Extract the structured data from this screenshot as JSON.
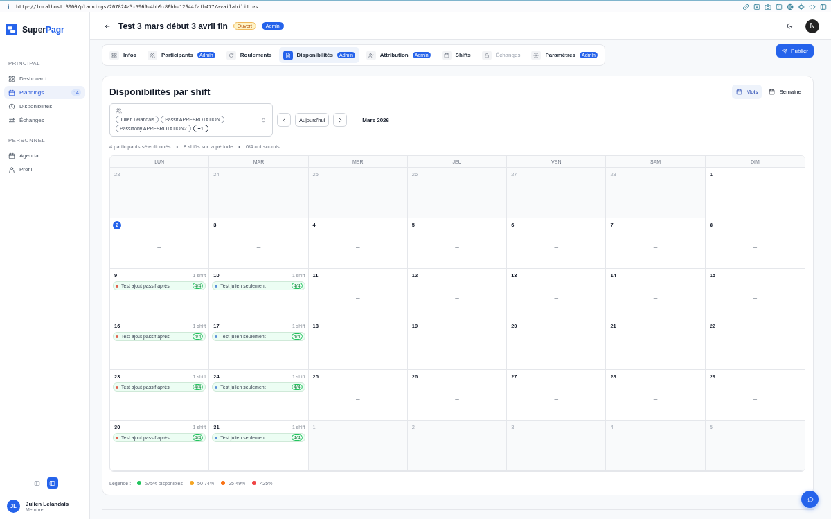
{
  "browser": {
    "url": "http://localhost:3000/plannings/207824a3-5969-4bb9-86bb-12644fafb477/availabilities"
  },
  "brand": {
    "lead": "Super",
    "accent": "Pagr"
  },
  "sidebar": {
    "sections": [
      {
        "title": "PRINCIPAL",
        "items": [
          {
            "label": "Dashboard",
            "selected": false
          },
          {
            "label": "Plannings",
            "selected": true,
            "badge": "14"
          },
          {
            "label": "Disponibilités",
            "selected": false
          },
          {
            "label": "Échanges",
            "selected": false
          }
        ]
      },
      {
        "title": "PERSONNEL",
        "items": [
          {
            "label": "Agenda",
            "selected": false
          },
          {
            "label": "Profil",
            "selected": false
          }
        ]
      }
    ],
    "layout_toggles": [
      {
        "selected": false
      },
      {
        "selected": true
      }
    ],
    "user": {
      "initials": "JL",
      "name": "Julien Lelandais",
      "role": "Membre"
    }
  },
  "header": {
    "title": "Test 3 mars début 3 avril fin",
    "status": "Ouvert",
    "role_badge": "Admin",
    "avatar": "N"
  },
  "tabs": [
    {
      "label": "Infos",
      "selected": false,
      "disabled": false
    },
    {
      "label": "Participants",
      "badge": "Admin",
      "selected": false,
      "disabled": false
    },
    {
      "label": "Roulements",
      "selected": false,
      "disabled": false
    },
    {
      "label": "Disponibilités",
      "badge": "Admin",
      "selected": true,
      "disabled": false
    },
    {
      "label": "Attribution",
      "badge": "Admin",
      "selected": false,
      "disabled": false
    },
    {
      "label": "Shifts",
      "selected": false,
      "disabled": false
    },
    {
      "label": "Échanges",
      "selected": false,
      "disabled": true
    },
    {
      "label": "Paramètres",
      "badge": "Admin",
      "selected": false,
      "disabled": false
    }
  ],
  "publish_button": "Publier",
  "card": {
    "title": "Disponibilités par shift",
    "views": [
      {
        "label": "Mois",
        "selected": true
      },
      {
        "label": "Semaine",
        "selected": false
      }
    ],
    "participants": [
      {
        "label": "Julien Lelandais",
        "kind": "chip"
      },
      {
        "label": "Passif APRESROTATION",
        "kind": "chip"
      },
      {
        "label": "Passiftony APRESROTATION2",
        "kind": "chip"
      },
      {
        "label": "+1",
        "kind": "more"
      }
    ],
    "today_button": "Aujourd'hui",
    "period": "Mars 2026",
    "stats": [
      "4 participants sélectionnés",
      "•",
      "8 shifts sur la période",
      "•",
      "0/4 ont soumis"
    ],
    "calendar": {
      "weekdays": [
        "LUN",
        "MAR",
        "MER",
        "JEU",
        "VEN",
        "SAM",
        "DIM"
      ],
      "weeks": [
        [
          {
            "day": "23",
            "in_month": false,
            "today": false
          },
          {
            "day": "24",
            "in_month": false,
            "today": false
          },
          {
            "day": "25",
            "in_month": false,
            "today": false
          },
          {
            "day": "26",
            "in_month": false,
            "today": false
          },
          {
            "day": "27",
            "in_month": false,
            "today": false
          },
          {
            "day": "28",
            "in_month": false,
            "today": false
          },
          {
            "day": "1",
            "in_month": true,
            "today": false,
            "empty_mark": "–"
          }
        ],
        [
          {
            "day": "2",
            "in_month": true,
            "today": true,
            "empty_mark": "–"
          },
          {
            "day": "3",
            "in_month": true,
            "today": false,
            "empty_mark": "–"
          },
          {
            "day": "4",
            "in_month": true,
            "today": false,
            "empty_mark": "–"
          },
          {
            "day": "5",
            "in_month": true,
            "today": false,
            "empty_mark": "–"
          },
          {
            "day": "6",
            "in_month": true,
            "today": false,
            "empty_mark": "–"
          },
          {
            "day": "7",
            "in_month": true,
            "today": false,
            "empty_mark": "–"
          },
          {
            "day": "8",
            "in_month": true,
            "today": false,
            "empty_mark": "–"
          }
        ],
        [
          {
            "day": "9",
            "in_month": true,
            "today": false,
            "count": "1 shift",
            "events": [
              {
                "title": "Test ajout passif après",
                "color": "#e0604e",
                "ratio": "4/4"
              }
            ]
          },
          {
            "day": "10",
            "in_month": true,
            "today": false,
            "count": "1 shift",
            "events": [
              {
                "title": "Test julien seulement",
                "color": "#5a8fd8",
                "ratio": "4/4"
              }
            ]
          },
          {
            "day": "11",
            "in_month": true,
            "today": false,
            "empty_mark": "–"
          },
          {
            "day": "12",
            "in_month": true,
            "today": false,
            "empty_mark": "–"
          },
          {
            "day": "13",
            "in_month": true,
            "today": false,
            "empty_mark": "–"
          },
          {
            "day": "14",
            "in_month": true,
            "today": false,
            "empty_mark": "–"
          },
          {
            "day": "15",
            "in_month": true,
            "today": false,
            "empty_mark": "–"
          }
        ],
        [
          {
            "day": "16",
            "in_month": true,
            "today": false,
            "count": "1 shift",
            "events": [
              {
                "title": "Test ajout passif après",
                "color": "#e0604e",
                "ratio": "4/4"
              }
            ]
          },
          {
            "day": "17",
            "in_month": true,
            "today": false,
            "count": "1 shift",
            "events": [
              {
                "title": "Test julien seulement",
                "color": "#5a8fd8",
                "ratio": "4/4"
              }
            ]
          },
          {
            "day": "18",
            "in_month": true,
            "today": false,
            "empty_mark": "–"
          },
          {
            "day": "19",
            "in_month": true,
            "today": false,
            "empty_mark": "–"
          },
          {
            "day": "20",
            "in_month": true,
            "today": false,
            "empty_mark": "–"
          },
          {
            "day": "21",
            "in_month": true,
            "today": false,
            "empty_mark": "–"
          },
          {
            "day": "22",
            "in_month": true,
            "today": false,
            "empty_mark": "–"
          }
        ],
        [
          {
            "day": "23",
            "in_month": true,
            "today": false,
            "count": "1 shift",
            "events": [
              {
                "title": "Test ajout passif après",
                "color": "#e0604e",
                "ratio": "4/4"
              }
            ]
          },
          {
            "day": "24",
            "in_month": true,
            "today": false,
            "count": "1 shift",
            "events": [
              {
                "title": "Test julien seulement",
                "color": "#5a8fd8",
                "ratio": "4/4"
              }
            ]
          },
          {
            "day": "25",
            "in_month": true,
            "today": false,
            "empty_mark": "–"
          },
          {
            "day": "26",
            "in_month": true,
            "today": false,
            "empty_mark": "–"
          },
          {
            "day": "27",
            "in_month": true,
            "today": false,
            "empty_mark": "–"
          },
          {
            "day": "28",
            "in_month": true,
            "today": false,
            "empty_mark": "–"
          },
          {
            "day": "29",
            "in_month": true,
            "today": false,
            "empty_mark": "–"
          }
        ],
        [
          {
            "day": "30",
            "in_month": true,
            "today": false,
            "count": "1 shift",
            "events": [
              {
                "title": "Test ajout passif après",
                "color": "#e0604e",
                "ratio": "4/4"
              }
            ]
          },
          {
            "day": "31",
            "in_month": true,
            "today": false,
            "count": "1 shift",
            "events": [
              {
                "title": "Test julien seulement",
                "color": "#5a8fd8",
                "ratio": "4/4"
              }
            ]
          },
          {
            "day": "1",
            "in_month": false,
            "today": false
          },
          {
            "day": "2",
            "in_month": false,
            "today": false
          },
          {
            "day": "3",
            "in_month": false,
            "today": false
          },
          {
            "day": "4",
            "in_month": false,
            "today": false
          },
          {
            "day": "5",
            "in_month": false,
            "today": false
          }
        ]
      ]
    },
    "legend": {
      "title": "Légende :",
      "items": [
        {
          "label": "≥75% disponibles",
          "color": "#22c55e"
        },
        {
          "label": "50-74%",
          "color": "#f5a524"
        },
        {
          "label": "25-49%",
          "color": "#f97316"
        },
        {
          "label": "<25%",
          "color": "#ef4444"
        }
      ]
    }
  }
}
